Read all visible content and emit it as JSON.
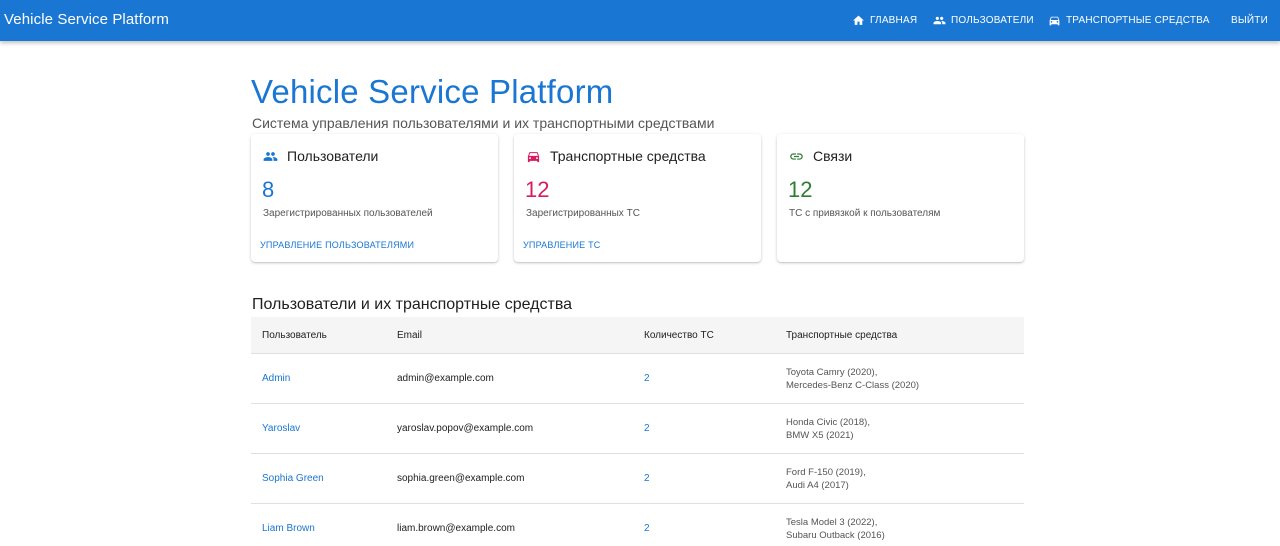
{
  "appbar": {
    "brand": "Vehicle Service Platform",
    "nav": {
      "home": "Главная",
      "users": "Пользователи",
      "vehicles": "Транспортные средства",
      "logout": "Выйти"
    }
  },
  "hero": {
    "title": "Vehicle Service Platform",
    "subtitle": "Система управления пользователями и их транспортными средствами"
  },
  "cards": [
    {
      "icon": "people-icon",
      "title": "Пользователи",
      "value": "8",
      "description": "Зарегистрированных пользователей",
      "link": "Управление пользователями",
      "color": "#1976d2"
    },
    {
      "icon": "car-icon",
      "title": "Транспортные средства",
      "value": "12",
      "description": "Зарегистрированных ТС",
      "link": "Управление ТС",
      "color": "#d81b60"
    },
    {
      "icon": "link-icon",
      "title": "Связи",
      "value": "12",
      "description": "ТС с привязкой к пользователям",
      "color": "#2e7d32"
    }
  ],
  "section": {
    "title": "Пользователи и их транспортные средства",
    "columns": [
      "Пользователь",
      "Email",
      "Количество ТС",
      "Транспортные средства"
    ],
    "rows": [
      {
        "name": "Admin",
        "email": "admin@example.com",
        "count": "2",
        "vehicles": [
          "Toyota Camry (2020),",
          "Mercedes-Benz C-Class (2020)"
        ]
      },
      {
        "name": "Yaroslav",
        "email": "yaroslav.popov@example.com",
        "count": "2",
        "vehicles": [
          "Honda Civic (2018),",
          "BMW X5 (2021)"
        ]
      },
      {
        "name": "Sophia Green",
        "email": "sophia.green@example.com",
        "count": "2",
        "vehicles": [
          "Ford F-150 (2019),",
          "Audi A4 (2017)"
        ]
      },
      {
        "name": "Liam Brown",
        "email": "liam.brown@example.com",
        "count": "2",
        "vehicles": [
          "Tesla Model 3 (2022),",
          "Subaru Outback (2016)"
        ]
      }
    ]
  }
}
